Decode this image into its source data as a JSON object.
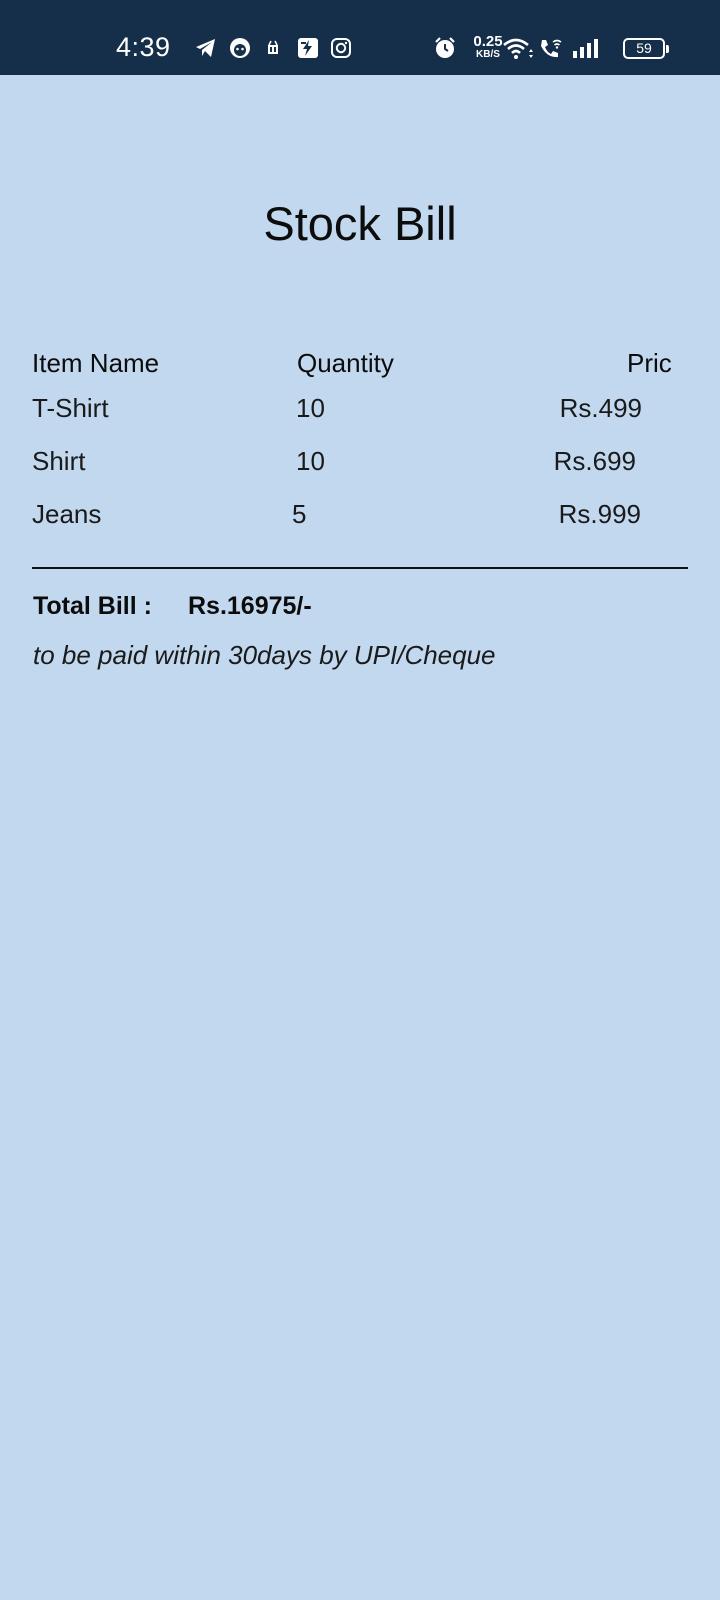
{
  "status_bar": {
    "time": "4:39",
    "net_speed_value": "0.25",
    "net_speed_unit": "KB/S",
    "battery": "59",
    "icons": [
      "telegram-icon",
      "messenger-icon",
      "notification-icon",
      "app-icon",
      "instagram-icon",
      "alarm-icon",
      "wifi-icon",
      "wifi-calling-icon",
      "signal-icon",
      "battery-icon"
    ]
  },
  "bill": {
    "title": "Stock Bill",
    "headers": {
      "item": "Item Name",
      "quantity": "Quantity",
      "price": "Pric"
    },
    "rows": [
      {
        "item": "T-Shirt",
        "quantity": "10",
        "price": "Rs.499"
      },
      {
        "item": "Shirt",
        "quantity": "10",
        "price": "Rs.699"
      },
      {
        "item": "Jeans",
        "quantity": "5",
        "price": "Rs.999"
      }
    ],
    "total_label": "Total Bill :",
    "total_value": "Rs.16975/-",
    "note": "to be paid within 30days by UPI/Cheque"
  },
  "colors": {
    "background": "#c2d8ee",
    "status_bar": "#152e49"
  }
}
